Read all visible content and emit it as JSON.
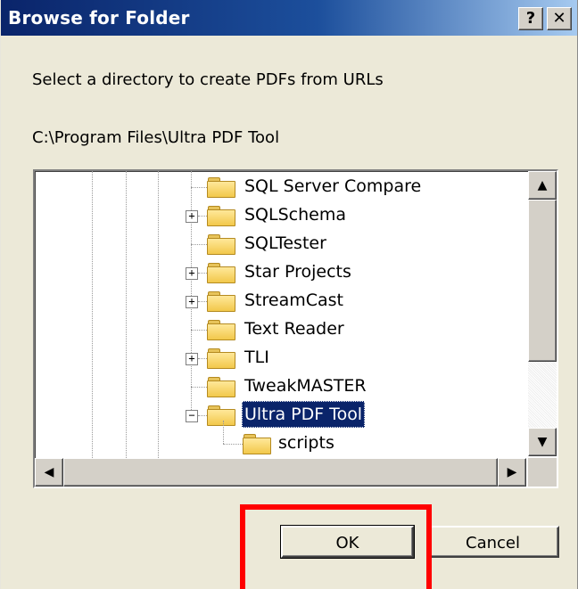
{
  "window": {
    "title": "Browse for Folder",
    "help_label": "?",
    "close_label": "✕"
  },
  "prompt": "Select a directory to create PDFs from URLs",
  "current_path": "C:\\Program Files\\Ultra PDF Tool",
  "tree": {
    "items": [
      {
        "label": "SQL Server Compare",
        "expandable": false
      },
      {
        "label": "SQLSchema",
        "expandable": true,
        "expander": "+"
      },
      {
        "label": "SQLTester",
        "expandable": false
      },
      {
        "label": "Star Projects",
        "expandable": true,
        "expander": "+"
      },
      {
        "label": "StreamCast",
        "expandable": true,
        "expander": "+"
      },
      {
        "label": "Text Reader",
        "expandable": false
      },
      {
        "label": "TLI",
        "expandable": true,
        "expander": "+"
      },
      {
        "label": "TweakMASTER",
        "expandable": false
      },
      {
        "label": "Ultra PDF Tool",
        "expandable": true,
        "expander": "−",
        "selected": true
      },
      {
        "label": "scripts",
        "expandable": false,
        "child": true
      }
    ]
  },
  "scrollbar": {
    "up_icon": "▲",
    "down_icon": "▼",
    "left_icon": "◀",
    "right_icon": "▶"
  },
  "buttons": {
    "ok_label": "OK",
    "cancel_label": "Cancel"
  },
  "colors": {
    "titlebar_start": "#0a246a",
    "selection": "#0a246a",
    "highlight": "#ff0000"
  }
}
